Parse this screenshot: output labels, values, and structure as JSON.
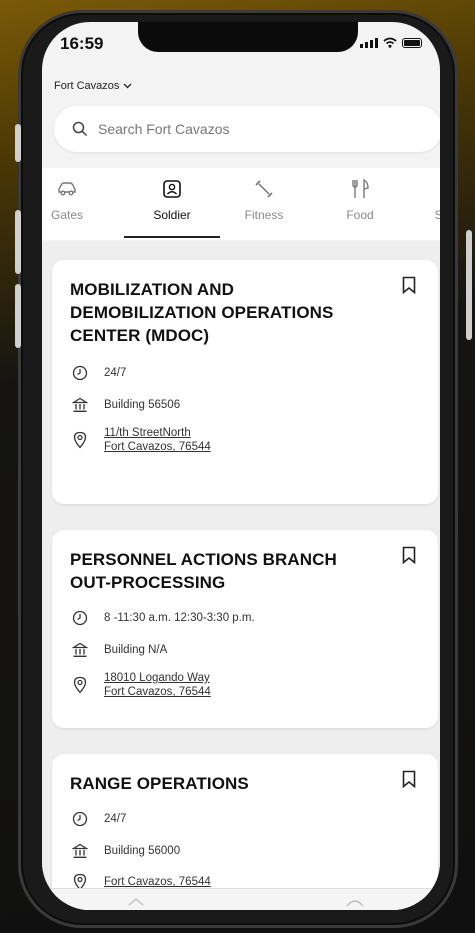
{
  "status_bar": {
    "time": "16:59"
  },
  "location": {
    "label": "Fort Cavazos"
  },
  "search": {
    "placeholder": "Search Fort Cavazos"
  },
  "tabs": [
    {
      "label": "Gates",
      "icon": "car-icon"
    },
    {
      "label": "Soldier",
      "icon": "id-badge-icon",
      "active": true
    },
    {
      "label": "Fitness",
      "icon": "dumbbell-icon"
    },
    {
      "label": "Food",
      "icon": "fork-knife-icon"
    },
    {
      "label": "Su",
      "icon": "partial-icon"
    }
  ],
  "cards": [
    {
      "title": "MOBILIZATION AND DEMOBILIZATION OPERATIONS CENTER (MDOC)",
      "hours": "24/7",
      "building": "Building 56506",
      "address_line1": "11/th StreetNorth",
      "address_line2": "Fort Cavazos, 76544"
    },
    {
      "title": "PERSONNEL ACTIONS BRANCH OUT-PROCESSING",
      "hours": "8 -11:30 a.m. 12:30-3:30 p.m.",
      "building": "Building N/A",
      "address_line1": "18010 Logando Way",
      "address_line2": "Fort Cavazos, 76544"
    },
    {
      "title": "RANGE OPERATIONS",
      "hours": "24/7",
      "building": "Building 56000",
      "address_line1": "Fort Cavazos, 76544"
    }
  ],
  "colors": {
    "accent_gold": "#7a5a08",
    "text": "#111111",
    "muted": "#8a8a8a"
  }
}
